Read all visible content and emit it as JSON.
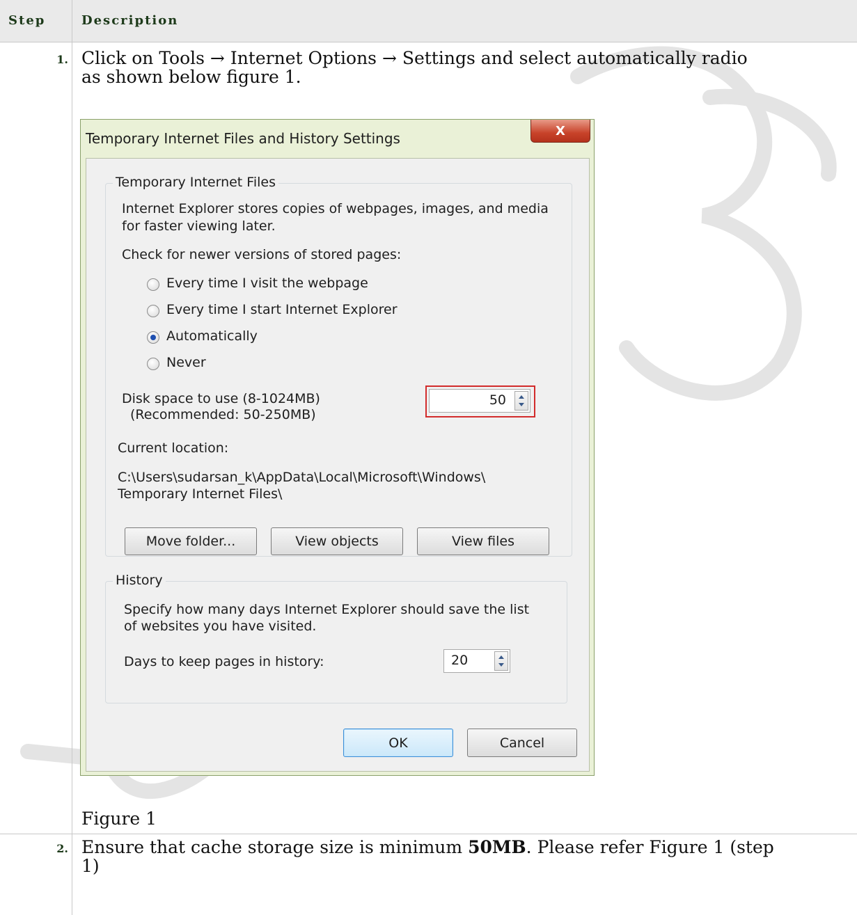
{
  "header": {
    "step": "Step",
    "description": "Description"
  },
  "steps": [
    {
      "number": "1.",
      "text_line1": "Click on Tools → Internet Options → Settings and select automatically radio",
      "text_line2": "as shown below figure 1.",
      "caption": "Figure 1"
    },
    {
      "number": "2.",
      "text_before": "Ensure that cache storage size is minimum ",
      "text_bold": "50MB",
      "text_after_line1": ". Please refer Figure 1 (step",
      "text_line2": "1)"
    }
  ],
  "dialog": {
    "title": "Temporary Internet Files and History Settings",
    "close_label": "X",
    "temp_files": {
      "legend": "Temporary Internet Files",
      "info_line1": "Internet Explorer stores copies of webpages, images, and media",
      "info_line2": "for faster viewing later.",
      "check_label": "Check for newer versions of stored pages:",
      "options": [
        {
          "label": "Every time I visit the webpage",
          "checked": false
        },
        {
          "label": "Every time I start Internet Explorer",
          "checked": false
        },
        {
          "label": "Automatically",
          "checked": true
        },
        {
          "label": "Never",
          "checked": false
        }
      ],
      "disk_label": "Disk space to use (8-1024MB)",
      "disk_recommended": "(Recommended: 50-250MB)",
      "disk_value": "50",
      "location_label": "Current location:",
      "location_line1": "C:\\Users\\sudarsan_k\\AppData\\Local\\Microsoft\\Windows\\",
      "location_line2": "Temporary Internet Files\\",
      "buttons": {
        "move": "Move folder...",
        "view_objects": "View objects",
        "view_files": "View files"
      }
    },
    "history": {
      "legend": "History",
      "info_line1": "Specify how many days Internet Explorer should save the list",
      "info_line2": "of websites you have visited.",
      "days_label": "Days to keep pages in history:",
      "days_value": "20"
    },
    "ok_label": "OK",
    "cancel_label": "Cancel"
  },
  "colors": {
    "highlight": "#d22b2b",
    "header_bg": "#eaeaea",
    "dialog_frame": "#eaf1d7"
  }
}
